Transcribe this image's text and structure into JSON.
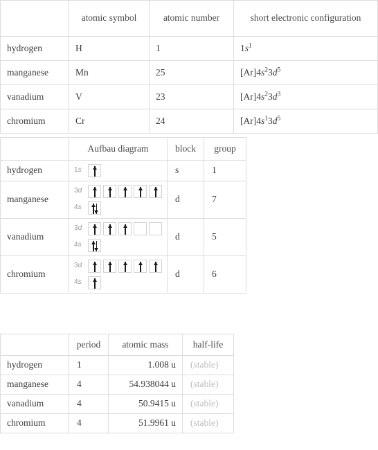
{
  "tables": {
    "identity": {
      "columns": [
        "",
        "atomic symbol",
        "atomic number",
        "short electronic configuration"
      ],
      "rows": [
        {
          "name": "hydrogen",
          "symbol": "H",
          "atomic_number": "1",
          "config": {
            "core": "",
            "terms": [
              {
                "n": "1",
                "orbital": "s",
                "count": "1"
              }
            ]
          }
        },
        {
          "name": "manganese",
          "symbol": "Mn",
          "atomic_number": "25",
          "config": {
            "core": "[Ar]",
            "terms": [
              {
                "n": "4",
                "orbital": "s",
                "count": "2"
              },
              {
                "n": "3",
                "orbital": "d",
                "count": "5"
              }
            ]
          }
        },
        {
          "name": "vanadium",
          "symbol": "V",
          "atomic_number": "23",
          "config": {
            "core": "[Ar]",
            "terms": [
              {
                "n": "4",
                "orbital": "s",
                "count": "2"
              },
              {
                "n": "3",
                "orbital": "d",
                "count": "3"
              }
            ]
          }
        },
        {
          "name": "chromium",
          "symbol": "Cr",
          "atomic_number": "24",
          "config": {
            "core": "[Ar]",
            "terms": [
              {
                "n": "4",
                "orbital": "s",
                "count": "1"
              },
              {
                "n": "3",
                "orbital": "d",
                "count": "5"
              }
            ]
          }
        }
      ]
    },
    "aufbau": {
      "columns": [
        "",
        "Aufbau diagram",
        "block",
        "group"
      ],
      "rows": [
        {
          "name": "hydrogen",
          "block": "s",
          "group": "1",
          "shells": [
            {
              "n": "1",
              "orbital": "s",
              "boxes": [
                "up"
              ]
            }
          ]
        },
        {
          "name": "manganese",
          "block": "d",
          "group": "7",
          "shells": [
            {
              "n": "3",
              "orbital": "d",
              "boxes": [
                "up",
                "up",
                "up",
                "up",
                "up"
              ]
            },
            {
              "n": "4",
              "orbital": "s",
              "boxes": [
                "updown"
              ]
            }
          ]
        },
        {
          "name": "vanadium",
          "block": "d",
          "group": "5",
          "shells": [
            {
              "n": "3",
              "orbital": "d",
              "boxes": [
                "up",
                "up",
                "up",
                "empty",
                "empty"
              ]
            },
            {
              "n": "4",
              "orbital": "s",
              "boxes": [
                "updown"
              ]
            }
          ]
        },
        {
          "name": "chromium",
          "block": "d",
          "group": "6",
          "shells": [
            {
              "n": "3",
              "orbital": "d",
              "boxes": [
                "up",
                "up",
                "up",
                "up",
                "up"
              ]
            },
            {
              "n": "4",
              "orbital": "s",
              "boxes": [
                "up"
              ]
            }
          ]
        }
      ]
    },
    "physical": {
      "columns": [
        "",
        "period",
        "atomic mass",
        "half-life"
      ],
      "rows": [
        {
          "name": "hydrogen",
          "period": "1",
          "atomic_mass": "1.008 u",
          "half_life": "(stable)"
        },
        {
          "name": "manganese",
          "period": "4",
          "atomic_mass": "54.938044 u",
          "half_life": "(stable)"
        },
        {
          "name": "vanadium",
          "period": "4",
          "atomic_mass": "50.9415 u",
          "half_life": "(stable)"
        },
        {
          "name": "chromium",
          "period": "4",
          "atomic_mass": "51.9961 u",
          "half_life": "(stable)"
        }
      ]
    }
  },
  "colors": {
    "border": "#dcdcdc",
    "text": "#3c3c3c",
    "muted": "#9a9a9a",
    "stable": "#bdbdbd",
    "arrow": "#1a1a1a",
    "background": "#ffffff"
  }
}
